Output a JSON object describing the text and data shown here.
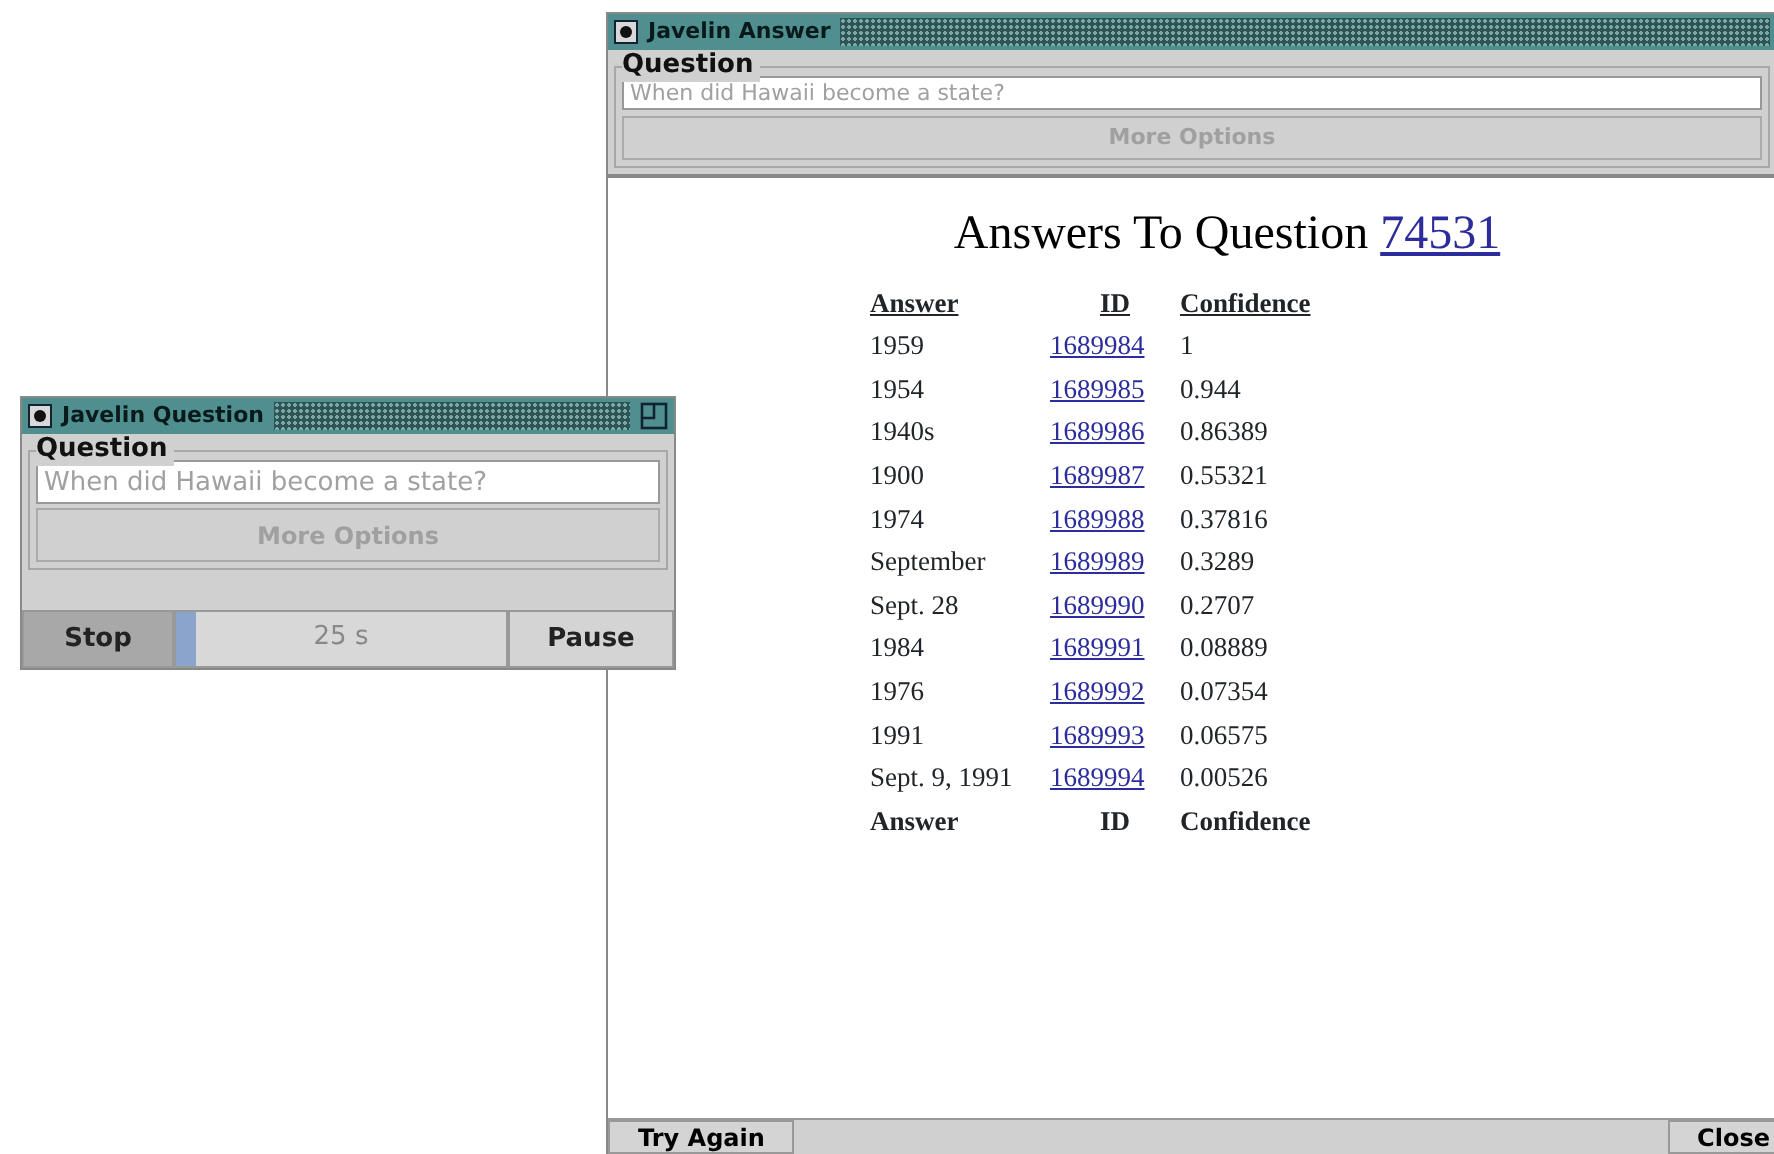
{
  "question_window": {
    "title": "Javelin Question",
    "group_label": "Question",
    "question_field": {
      "placeholder": "When did Hawaii become a state?"
    },
    "more_options": {
      "label": "More Options",
      "disabled": true
    },
    "stop_button": "Stop",
    "timer": {
      "level": 0.06,
      "reading": "25 s"
    },
    "pause_button": "Pause"
  },
  "answer_window": {
    "title": "Javelin Answer",
    "group_label": "Question",
    "question_field": {
      "placeholder": "When did Hawaii become a state?"
    },
    "more_options": {
      "label": "More Options",
      "disabled": true
    },
    "heading": "Answers To Question",
    "question_id": "74531",
    "table": {
      "columns": [
        "Answer",
        "ID",
        "Confidence"
      ],
      "rows": [
        {
          "answer": "1959",
          "id": "1689984",
          "confidence": "1"
        },
        {
          "answer": "1954",
          "id": "1689985",
          "confidence": "0.944"
        },
        {
          "answer": "1940s",
          "id": "1689986",
          "confidence": "0.86389"
        },
        {
          "answer": "1900",
          "id": "1689987",
          "confidence": "0.55321"
        },
        {
          "answer": "1974",
          "id": "1689988",
          "confidence": "0.37816"
        },
        {
          "answer": "September",
          "id": "1689989",
          "confidence": "0.3289"
        },
        {
          "answer": "Sept. 28",
          "id": "1689990",
          "confidence": "0.2707"
        },
        {
          "answer": "1984",
          "id": "1689991",
          "confidence": "0.08889"
        },
        {
          "answer": "1976",
          "id": "1689992",
          "confidence": "0.07354"
        },
        {
          "answer": "1991",
          "id": "1689993",
          "confidence": "0.06575"
        },
        {
          "answer": "Sept. 9, 1991",
          "id": "1689994",
          "confidence": "0.00526"
        }
      ],
      "footer": [
        "Answer",
        "ID",
        "Confidence"
      ]
    },
    "buttons": [
      "Try Again",
      "Close"
    ]
  }
}
